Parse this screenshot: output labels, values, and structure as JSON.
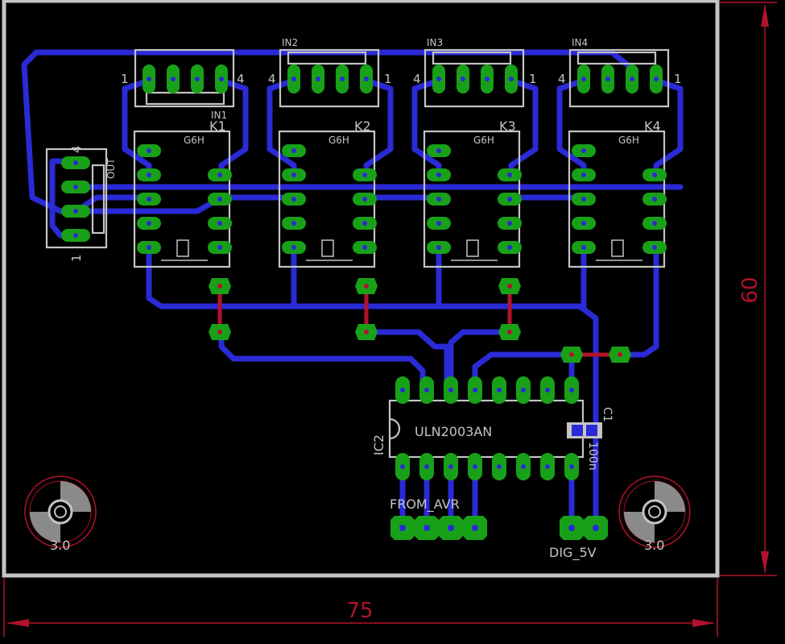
{
  "dimensions": {
    "width_label": "75",
    "height_label": "60"
  },
  "colors": {
    "background": "#000000",
    "board_outline": "#c4c4c4",
    "trace": "#2a2ad6",
    "pad": "#19a019",
    "dimension": "#b3122b"
  },
  "connectors": [
    {
      "name": "IN1",
      "pin_left": "1",
      "pin_right": "4"
    },
    {
      "name": "IN2",
      "pin_left": "4",
      "pin_right": "1"
    },
    {
      "name": "IN3",
      "pin_left": "4",
      "pin_right": "1"
    },
    {
      "name": "IN4",
      "pin_left": "4",
      "pin_right": "1"
    }
  ],
  "relays": [
    {
      "name": "K1",
      "type": "G6H"
    },
    {
      "name": "K2",
      "type": "G6H"
    },
    {
      "name": "K3",
      "type": "G6H"
    },
    {
      "name": "K4",
      "type": "G6H"
    }
  ],
  "out_connector": {
    "name": "OUT",
    "pin_top": "4",
    "pin_bottom": "1"
  },
  "ic": {
    "ref": "IC2",
    "value": "ULN2003AN"
  },
  "capacitor": {
    "ref": "C1",
    "value": "100n"
  },
  "headers": {
    "from_avr": "FROM_AVR",
    "dig_5v": "DIG_5V"
  },
  "mount_holes": {
    "left_label": "3.0",
    "right_label": "3.0"
  }
}
